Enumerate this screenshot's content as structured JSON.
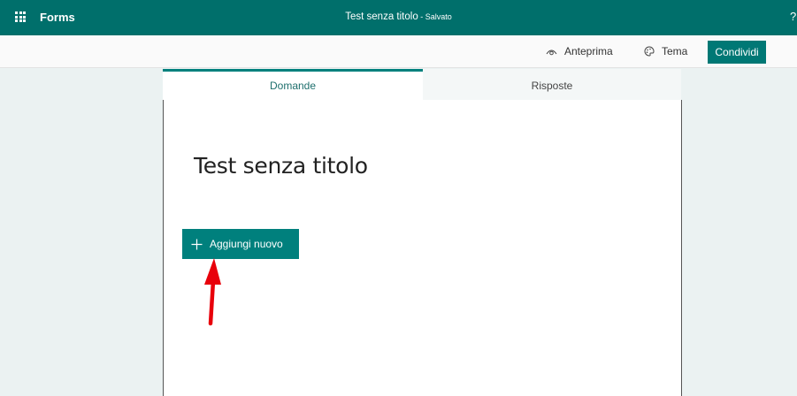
{
  "topbar": {
    "brand": "Forms",
    "doc_title": "Test senza titolo",
    "doc_status": " - Salvato",
    "help": "?"
  },
  "commands": {
    "preview": "Anteprima",
    "theme": "Tema",
    "share": "Condividi"
  },
  "tabs": [
    {
      "label": "Domande",
      "active": true
    },
    {
      "label": "Risposte",
      "active": false
    }
  ],
  "form": {
    "title": "Test senza titolo",
    "add_new": "Aggiungi nuovo"
  },
  "colors": {
    "accent": "#006f6b",
    "button": "#00807d",
    "annotation_arrow": "#e8000b"
  }
}
